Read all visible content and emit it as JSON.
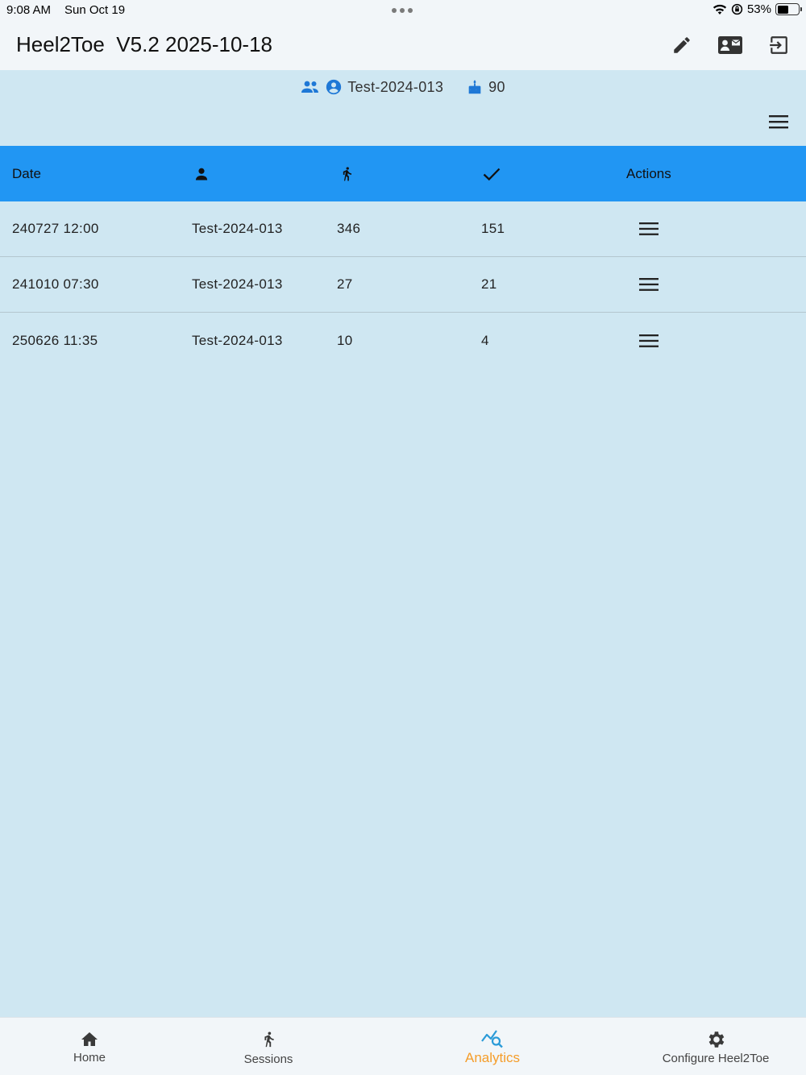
{
  "status_bar": {
    "time": "9:08 AM",
    "date": "Sun Oct 19",
    "battery": "53%",
    "battery_level": 0.53
  },
  "app": {
    "title": "Heel2Toe  V5.2 2025-10-18"
  },
  "header_info": {
    "participant": "Test-2024-013",
    "age": "90"
  },
  "table": {
    "columns": {
      "date": "Date",
      "actions": "Actions"
    },
    "rows": [
      {
        "date": "240727 12:00",
        "participant": "Test-2024-013",
        "steps": "346",
        "valid": "151"
      },
      {
        "date": "241010 07:30",
        "participant": "Test-2024-013",
        "steps": "27",
        "valid": "21"
      },
      {
        "date": "250626 11:35",
        "participant": "Test-2024-013",
        "steps": "10",
        "valid": "4"
      }
    ]
  },
  "nav": {
    "home": "Home",
    "sessions": "Sessions",
    "analytics": "Analytics",
    "configure": "Configure Heel2Toe"
  },
  "colors": {
    "accent": "#2196f3",
    "background": "#cfe7f2",
    "active_tab": "#f59d2a",
    "icon_blue": "#1e78d6"
  }
}
